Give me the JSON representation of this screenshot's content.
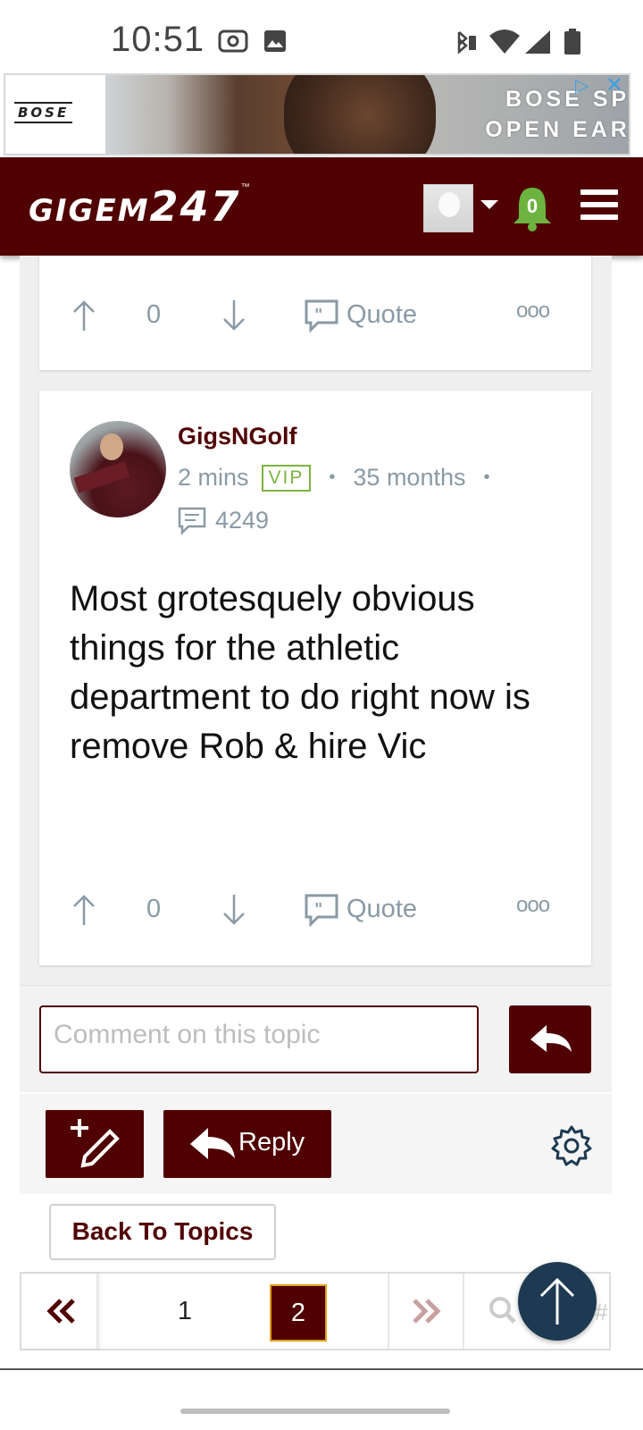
{
  "status_bar": {
    "time": "10:51"
  },
  "ad": {
    "brand": "BOSE",
    "line1": "BOSE SPORT",
    "line2": "OPEN EARBUDS"
  },
  "header": {
    "brand_part1": "GIGEM",
    "brand_part2": "247",
    "trademark": "™",
    "notification_count": "0"
  },
  "previous_post": {
    "vote_count": "0",
    "quote_label": "Quote",
    "more_label": "ooo"
  },
  "post": {
    "username": "GigsNGolf",
    "time_ago": "2 mins",
    "badge": "VIP",
    "membership": "35 months",
    "separator": "•",
    "post_count": "4249",
    "body": "Most grotesquely obvious things for the athletic department to do right now is remove Rob & hire Vic",
    "vote_count": "0",
    "quote_label": "Quote",
    "more_label": "ooo"
  },
  "comment": {
    "placeholder": "Comment on this topic"
  },
  "toolbar": {
    "reply_label": "Reply"
  },
  "back_to_topics": "Back To Topics",
  "pagination": {
    "page1": "1",
    "page2": "2",
    "current": "2",
    "hash": "#"
  },
  "colors": {
    "maroon": "#500000",
    "vip_green": "#7cb342",
    "meta_gray": "#8a9aa5",
    "fab_blue": "#1e3a52"
  }
}
